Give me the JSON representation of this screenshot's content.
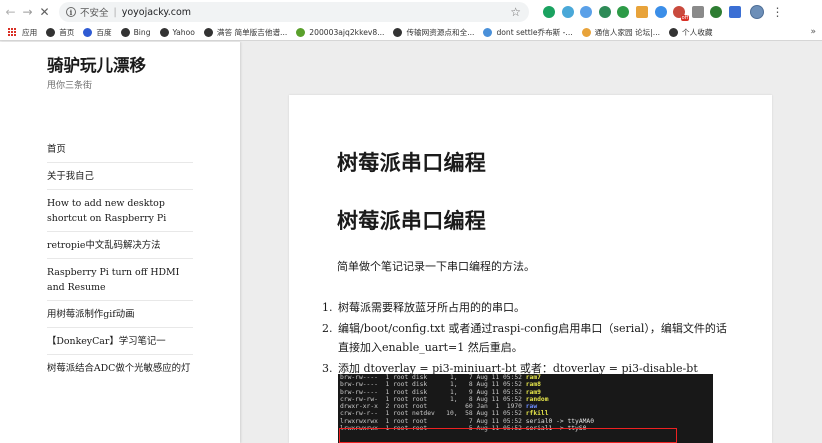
{
  "browser": {
    "insecure_label": "不安全",
    "separator": "|",
    "url": "yoyojacky.com",
    "ext_colors": [
      "#1aa260",
      "#4aa8d8",
      "#5aa0e8",
      "#2e8b57",
      "#2d9b47",
      "#e8a33a",
      "#3b8ee8",
      "#c94a3d",
      "#8a8a8a",
      "#2e7d32",
      "#3b6fd4"
    ],
    "badge_text": "off"
  },
  "bookmarks": {
    "items": [
      {
        "label": "应用",
        "color": "#d93025"
      },
      {
        "label": "首页",
        "color": "#333333"
      },
      {
        "label": "百度",
        "color": "#2f5bd3"
      },
      {
        "label": "Bing",
        "color": "#333333"
      },
      {
        "label": "Yahoo",
        "color": "#333333"
      },
      {
        "label": "满答 简单版吉他谱...",
        "color": "#333333"
      },
      {
        "label": "200003ajq2kkev8...",
        "color": "#5aa02c"
      },
      {
        "label": "传输网资源点和全...",
        "color": "#333333"
      },
      {
        "label": "dont settle乔布斯 -...",
        "color": "#4a90d9"
      },
      {
        "label": "通信人家园 论坛|...",
        "color": "#e8a33a"
      },
      {
        "label": "个人收藏",
        "color": "#333333"
      }
    ],
    "more": "»"
  },
  "sidebar": {
    "site_title": "骑驴玩儿漂移",
    "site_desc": "甩你三条街",
    "items": [
      {
        "label": "首页"
      },
      {
        "label": "关于我自己"
      },
      {
        "label": "How to add new desktop shortcut on Raspberry Pi"
      },
      {
        "label": "retropie中文乱码解决方法"
      },
      {
        "label": "Raspberry Pi turn off HDMI and Resume"
      },
      {
        "label": "用树莓派制作gif动画"
      },
      {
        "label": "【DonkeyCar】学习笔记一"
      },
      {
        "label": "树莓派结合ADC做个光敏感应的灯"
      }
    ]
  },
  "post": {
    "title": "树莓派串口编程",
    "heading": "树莓派串口编程",
    "intro": "简单做个笔记记录一下串口编程的方法。",
    "list": [
      {
        "num": "1.",
        "text": "树莓派需要释放蓝牙所占用的的串口。"
      },
      {
        "num": "2.",
        "text": "编辑/boot/config.txt 或者通过raspi-config启用串口（serial），编辑文件的话直接加入enable_uart=1 然后重启。"
      },
      {
        "num": "3.",
        "text": "添加 dtoverlay = pi3-miniuart-bt 或者：dtoverlay = pi3-disable-bt"
      }
    ]
  },
  "terminal": {
    "lines": [
      {
        "meta": "brw-rw----  1 root disk      1,   7 Aug 11 05:52 ",
        "name": "ram7",
        "kind": "yellow"
      },
      {
        "meta": "brw-rw----  1 root disk      1,   8 Aug 11 05:52 ",
        "name": "ram8",
        "kind": "yellow"
      },
      {
        "meta": "brw-rw----  1 root disk      1,   9 Aug 11 05:52 ",
        "name": "ram9",
        "kind": "yellow"
      },
      {
        "meta": "crw-rw-rw-  1 root root      1,   8 Aug 11 05:52 ",
        "name": "random",
        "kind": "yellow"
      },
      {
        "meta": "drwxr-xr-x  2 root root          60 Jan  1  1970 ",
        "name": "raw",
        "kind": "blue"
      },
      {
        "meta": "crw-rw-r--  1 root netdev   10,  58 Aug 11 05:52 ",
        "name": "rfkill",
        "kind": "yellow"
      },
      {
        "meta": "lrwxrwxrwx  1 root root           7 Aug 11 05:52 ",
        "name": "serial0 -> ttyAMA0",
        "kind": "white"
      },
      {
        "meta": "lrwxrwxrwx  1 root root           5 Aug 11 05:52 ",
        "name": "serial1 -> ttyS0",
        "kind": "white"
      }
    ]
  }
}
